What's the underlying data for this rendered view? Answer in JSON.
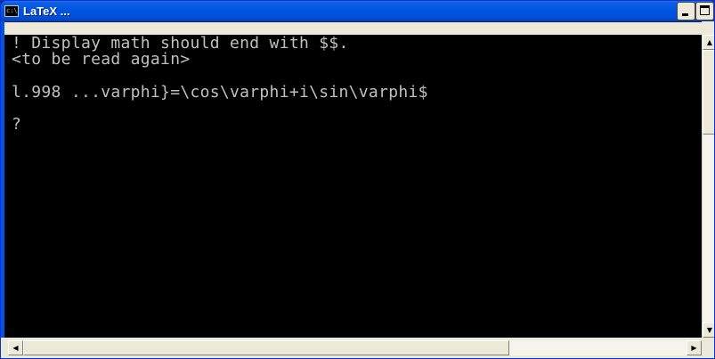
{
  "window": {
    "title": "LaTeX ...",
    "icon": "console-icon",
    "icon_glyph": "c:\\"
  },
  "titlebar_buttons": {
    "minimize_icon": "minimize-icon",
    "maximize_icon": "maximize-icon",
    "close_icon": "close-icon",
    "close_glyph": "×"
  },
  "console": {
    "lines": [
      "! Display math should end with $$.",
      "<to be read again>",
      "l.998 ...varphi}=\\cos\\varphi+i\\sin\\varphi$",
      "?"
    ]
  },
  "scrollbars": {
    "up_arrow": "▲",
    "down_arrow": "▼",
    "left_arrow": "◀",
    "right_arrow": "▶"
  },
  "colors": {
    "console_background": "#000000",
    "console_text": "#c0c0c0",
    "titlebar_blue": "#0054e3"
  }
}
